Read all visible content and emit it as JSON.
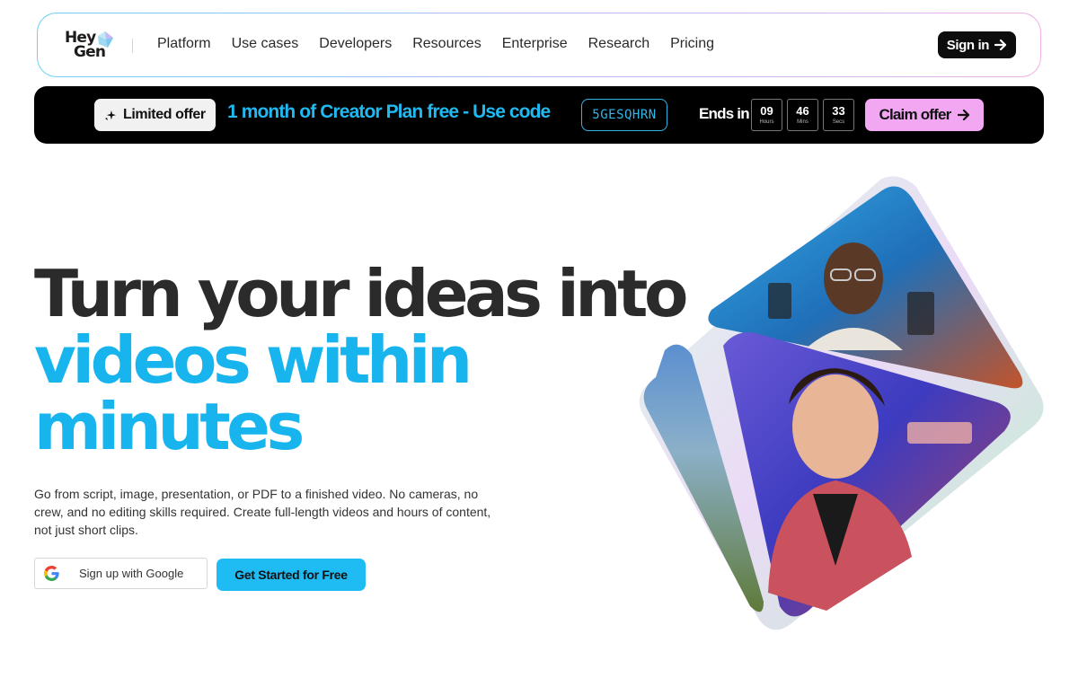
{
  "nav": {
    "logo_line1": "Hey",
    "logo_line2": "Gen",
    "links": [
      "Platform",
      "Use cases",
      "Developers",
      "Resources",
      "Enterprise",
      "Research",
      "Pricing"
    ],
    "signin_label": "Sign in"
  },
  "promo": {
    "badge_label": "Limited offer",
    "offer_text": "1 month of Creator Plan free -  Use code",
    "code": "5GESQHRN",
    "ends_label": "Ends in",
    "timer": [
      {
        "value": "09",
        "unit": "Hours"
      },
      {
        "value": "46",
        "unit": "Mins"
      },
      {
        "value": "33",
        "unit": "Secs"
      }
    ],
    "claim_label": "Claim offer"
  },
  "hero": {
    "line1": "Turn your ideas into",
    "line2": "videos within",
    "line3": "minutes",
    "description": "Go from script, image, presentation, or PDF to a finished video. No cameras, no crew, and no editing skills required. Create full-length videos and hours of content, not just short clips.",
    "google_label": "Sign up with Google",
    "cta_label": "Get Started for Free"
  },
  "colors": {
    "accent": "#18b4ee",
    "claim": "#f1a7f2",
    "promo_bg": "#000000"
  }
}
